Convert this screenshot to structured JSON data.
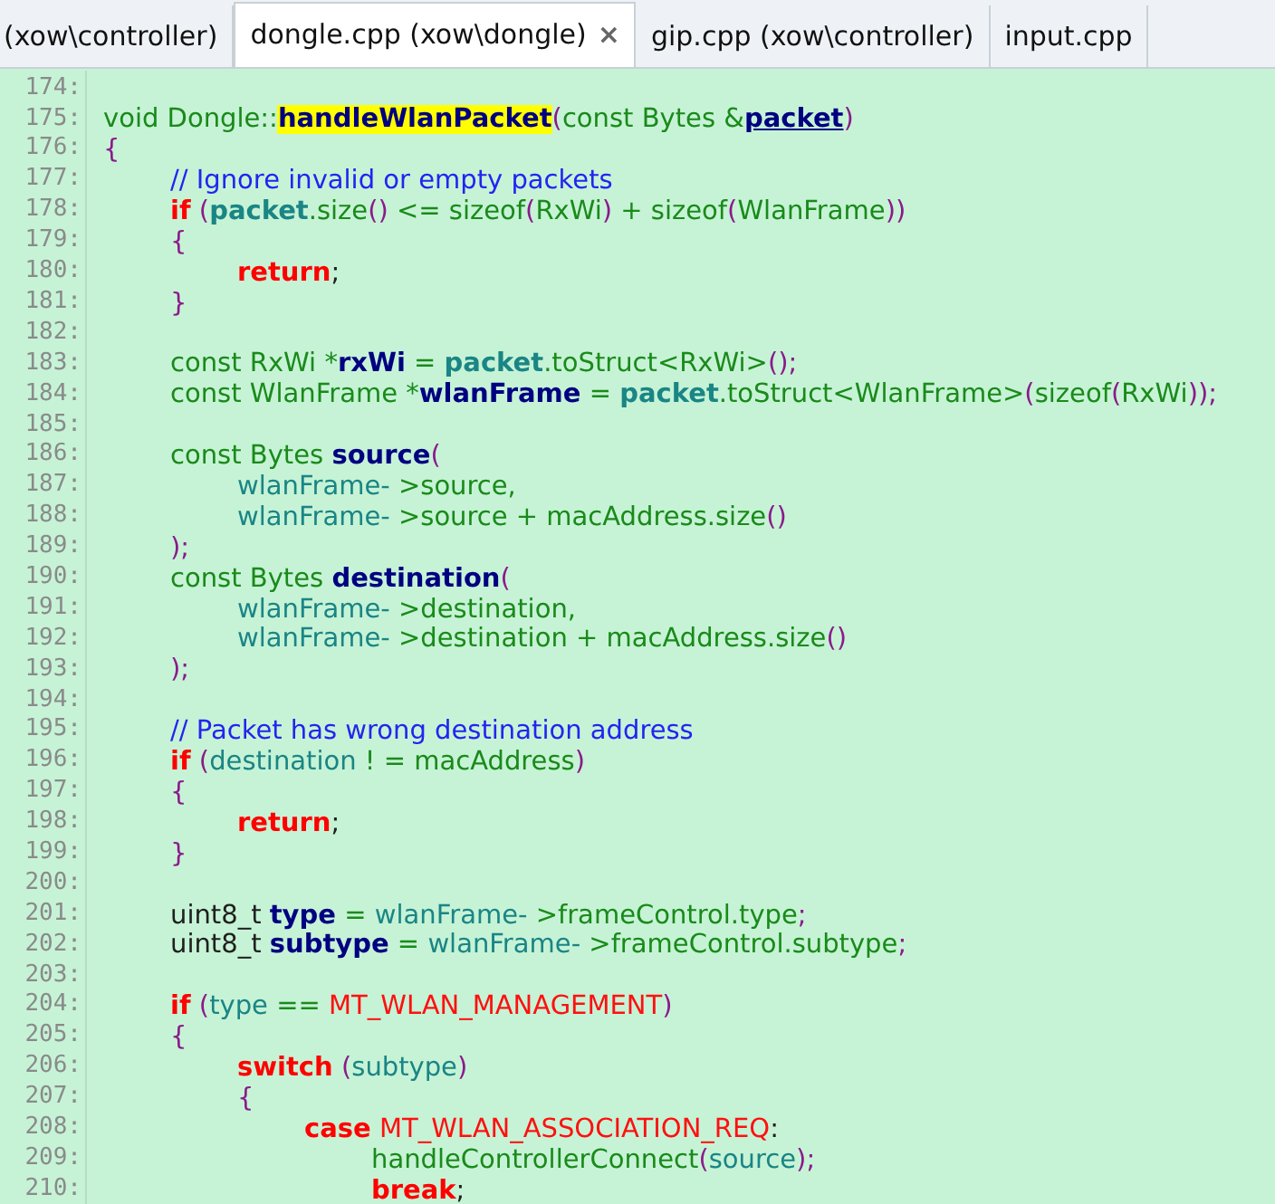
{
  "tabs": [
    {
      "label": "(xow\\controller)",
      "selected": false
    },
    {
      "label": "dongle.cpp (xow\\dongle)",
      "selected": true,
      "close": "×"
    },
    {
      "label": "gip.cpp (xow\\controller)",
      "selected": false
    },
    {
      "label": "input.cpp",
      "selected": false
    }
  ],
  "lines": [
    {
      "number": "174:"
    },
    {
      "number": "175:",
      "tokens": [
        {
          "text": "void Dongle::",
          "kind": "plain"
        },
        {
          "text": "handleWlanPacket",
          "kind": "highlight"
        },
        {
          "text": "(",
          "kind": "punct"
        },
        {
          "text": "const Bytes &",
          "kind": "plain"
        },
        {
          "text": "packet",
          "kind": "param"
        },
        {
          "text": ")",
          "kind": "punct"
        }
      ]
    },
    {
      "number": "176:",
      "tokens": [
        {
          "text": "{",
          "kind": "punct"
        }
      ],
      "children": [
        {
          "number": "177:",
          "tokens": [
            {
              "text": "// Ignore invalid or empty packets",
              "kind": "comment"
            }
          ]
        },
        {
          "number": "178:",
          "tokens": [
            {
              "text": "if",
              "kind": "keyword"
            },
            {
              "text": " (",
              "kind": "punct"
            },
            {
              "text": "packet",
              "kind": "ref"
            },
            {
              "text": ".size",
              "kind": "plain"
            },
            {
              "text": "()",
              "kind": "punct"
            },
            {
              "text": " <= sizeof",
              "kind": "plain"
            },
            {
              "text": "(",
              "kind": "punct"
            },
            {
              "text": "RxWi",
              "kind": "plain"
            },
            {
              "text": ")",
              "kind": "punct"
            },
            {
              "text": " + sizeof",
              "kind": "plain"
            },
            {
              "text": "(",
              "kind": "punct"
            },
            {
              "text": "WlanFrame",
              "kind": "plain"
            },
            {
              "text": "))",
              "kind": "punct"
            }
          ]
        },
        {
          "number": "179:",
          "tokens": [
            {
              "text": "{",
              "kind": "punct"
            }
          ],
          "children": [
            {
              "number": "180:",
              "tokens": [
                {
                  "text": "return",
                  "kind": "keyword"
                },
                {
                  "text": ";",
                  "kind": "dark"
                }
              ]
            }
          ]
        },
        {
          "number": "181:",
          "tokens": [
            {
              "text": "}",
              "kind": "punct"
            }
          ]
        },
        {
          "number": "182:"
        },
        {
          "number": "183:",
          "tokens": [
            {
              "text": "const RxWi *",
              "kind": "plain"
            },
            {
              "text": "rxWi",
              "kind": "var"
            },
            {
              "text": " = ",
              "kind": "plain"
            },
            {
              "text": "packet",
              "kind": "ref"
            },
            {
              "text": ".toStruct<RxWi>",
              "kind": "plain"
            },
            {
              "text": "();",
              "kind": "punct"
            }
          ]
        },
        {
          "number": "184:",
          "tokens": [
            {
              "text": "const WlanFrame *",
              "kind": "plain"
            },
            {
              "text": "wlanFrame",
              "kind": "var"
            },
            {
              "text": " = ",
              "kind": "plain"
            },
            {
              "text": "packet",
              "kind": "ref"
            },
            {
              "text": ".toStruct<WlanFrame>",
              "kind": "plain"
            },
            {
              "text": "(",
              "kind": "punct"
            },
            {
              "text": "sizeof",
              "kind": "plain"
            },
            {
              "text": "(",
              "kind": "punct"
            },
            {
              "text": "RxWi",
              "kind": "plain"
            },
            {
              "text": "));",
              "kind": "punct"
            }
          ]
        },
        {
          "number": "185:"
        },
        {
          "number": "186:",
          "tokens": [
            {
              "text": "const Bytes ",
              "kind": "plain"
            },
            {
              "text": "source",
              "kind": "var"
            },
            {
              "text": "(",
              "kind": "punct"
            }
          ],
          "children": [
            {
              "number": "187:",
              "tokens": [
                {
                  "text": "wlanFrame- ",
                  "kind": "member"
                },
                {
                  "text": ">source,",
                  "kind": "plain"
                }
              ]
            },
            {
              "number": "188:",
              "tokens": [
                {
                  "text": "wlanFrame- ",
                  "kind": "member"
                },
                {
                  "text": ">source + macAddress.size",
                  "kind": "plain"
                },
                {
                  "text": "()",
                  "kind": "punct"
                }
              ]
            }
          ]
        },
        {
          "number": "189:",
          "tokens": [
            {
              "text": ");",
              "kind": "punct"
            }
          ]
        },
        {
          "number": "190:",
          "tokens": [
            {
              "text": "const Bytes ",
              "kind": "plain"
            },
            {
              "text": "destination",
              "kind": "var"
            },
            {
              "text": "(",
              "kind": "punct"
            }
          ],
          "children": [
            {
              "number": "191:",
              "tokens": [
                {
                  "text": "wlanFrame- ",
                  "kind": "member"
                },
                {
                  "text": ">destination,",
                  "kind": "plain"
                }
              ]
            },
            {
              "number": "192:",
              "tokens": [
                {
                  "text": "wlanFrame- ",
                  "kind": "member"
                },
                {
                  "text": ">destination + macAddress.size",
                  "kind": "plain"
                },
                {
                  "text": "()",
                  "kind": "punct"
                }
              ]
            }
          ]
        },
        {
          "number": "193:",
          "tokens": [
            {
              "text": ");",
              "kind": "punct"
            }
          ]
        },
        {
          "number": "194:"
        },
        {
          "number": "195:",
          "tokens": [
            {
              "text": "// Packet has wrong destination address",
              "kind": "comment"
            }
          ]
        },
        {
          "number": "196:",
          "tokens": [
            {
              "text": "if",
              "kind": "keyword"
            },
            {
              "text": " (",
              "kind": "punct"
            },
            {
              "text": "destination",
              "kind": "member"
            },
            {
              "text": " ! = macAddress",
              "kind": "plain"
            },
            {
              "text": ")",
              "kind": "punct"
            }
          ]
        },
        {
          "number": "197:",
          "tokens": [
            {
              "text": "{",
              "kind": "punct"
            }
          ],
          "children": [
            {
              "number": "198:",
              "tokens": [
                {
                  "text": "return",
                  "kind": "keyword"
                },
                {
                  "text": ";",
                  "kind": "dark"
                }
              ]
            }
          ]
        },
        {
          "number": "199:",
          "tokens": [
            {
              "text": "}",
              "kind": "punct"
            }
          ]
        },
        {
          "number": "200:"
        },
        {
          "number": "201:",
          "tokens": [
            {
              "text": "uint8_t ",
              "kind": "type"
            },
            {
              "text": "type",
              "kind": "var"
            },
            {
              "text": " = ",
              "kind": "plain"
            },
            {
              "text": "wlanFrame- ",
              "kind": "member"
            },
            {
              "text": ">frameControl.type",
              "kind": "plain"
            },
            {
              "text": ";",
              "kind": "punct"
            }
          ]
        },
        {
          "number": "202:",
          "tokens": [
            {
              "text": "uint8_t ",
              "kind": "type"
            },
            {
              "text": "subtype",
              "kind": "var"
            },
            {
              "text": " = ",
              "kind": "plain"
            },
            {
              "text": "wlanFrame- ",
              "kind": "member"
            },
            {
              "text": ">frameControl.subtype",
              "kind": "plain"
            },
            {
              "text": ";",
              "kind": "punct"
            }
          ]
        },
        {
          "number": "203:"
        },
        {
          "number": "204:",
          "tokens": [
            {
              "text": "if",
              "kind": "keyword"
            },
            {
              "text": " (",
              "kind": "punct"
            },
            {
              "text": "type",
              "kind": "member"
            },
            {
              "text": " == ",
              "kind": "plain"
            },
            {
              "text": "MT_WLAN_MANAGEMENT",
              "kind": "macro"
            },
            {
              "text": ")",
              "kind": "punct"
            }
          ]
        },
        {
          "number": "205:",
          "tokens": [
            {
              "text": "{",
              "kind": "punct"
            }
          ],
          "children": [
            {
              "number": "206:",
              "tokens": [
                {
                  "text": "switch",
                  "kind": "keyword"
                },
                {
                  "text": " (",
                  "kind": "punct"
                },
                {
                  "text": "subtype",
                  "kind": "member"
                },
                {
                  "text": ")",
                  "kind": "punct"
                }
              ]
            },
            {
              "number": "207:",
              "tokens": [
                {
                  "text": "{",
                  "kind": "punct"
                }
              ],
              "children": [
                {
                  "number": "208:",
                  "tokens": [
                    {
                      "text": "case",
                      "kind": "keyword"
                    },
                    {
                      "text": " MT_WLAN_ASSOCIATION_REQ",
                      "kind": "macro"
                    },
                    {
                      "text": ":",
                      "kind": "dark"
                    }
                  ],
                  "children": [
                    {
                      "number": "209:",
                      "tokens": [
                        {
                          "text": "handleControllerConnect",
                          "kind": "plain"
                        },
                        {
                          "text": "(",
                          "kind": "punct"
                        },
                        {
                          "text": "source",
                          "kind": "member"
                        },
                        {
                          "text": ");",
                          "kind": "punct"
                        }
                      ]
                    },
                    {
                      "number": "210:",
                      "tokens": [
                        {
                          "text": "break",
                          "kind": "keyword"
                        },
                        {
                          "text": ";",
                          "kind": "dark"
                        }
                      ]
                    }
                  ]
                }
              ]
            }
          ]
        }
      ]
    }
  ]
}
